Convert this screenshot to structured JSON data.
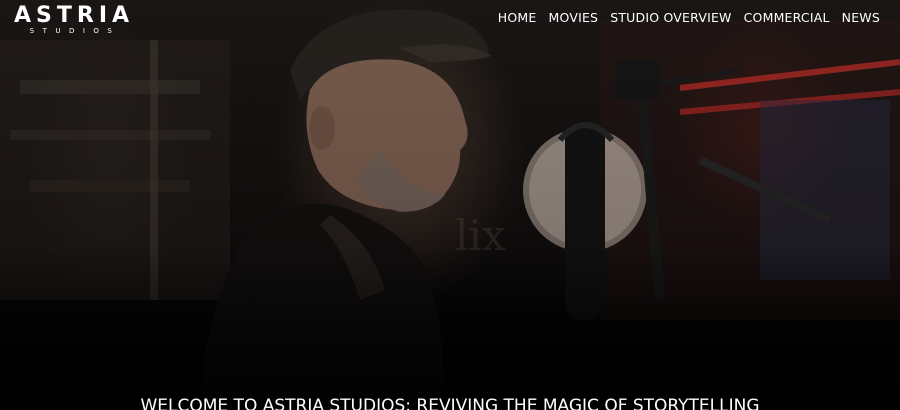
{
  "logo": {
    "main": "ASTRIA",
    "sub": "STUDIOS"
  },
  "nav": {
    "items": [
      {
        "label": "HOME"
      },
      {
        "label": "MOVIES"
      },
      {
        "label": "STUDIO OVERVIEW"
      },
      {
        "label": "COMMERCIAL"
      },
      {
        "label": "NEWS"
      }
    ]
  },
  "hero": {
    "headline": "WELCOME TO ASTRIA STUDIOS: REVIVING THE MAGIC OF STORYTELLING",
    "background_image": "man-at-podcast-microphone-photo"
  },
  "colors": {
    "text": "#ffffff",
    "background": "#050507",
    "accent_red": "#c2302a"
  }
}
